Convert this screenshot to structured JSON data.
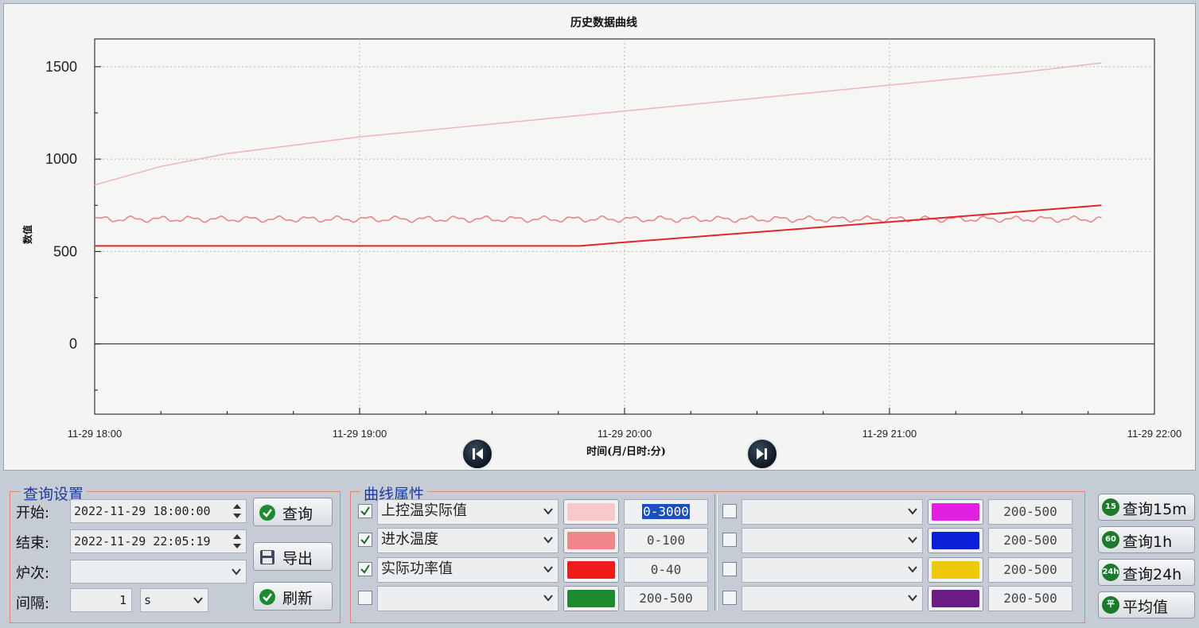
{
  "chart": {
    "title": "历史数据曲线",
    "ylabel": "数值",
    "xlabel": "时间(月/日时:分)",
    "ytick_labels": [
      "1500",
      "1000",
      "500",
      "0"
    ],
    "xtick_labels": [
      "11-29 18:00",
      "11-29 19:00",
      "11-29 20:00",
      "11-29 21:00",
      "11-29 22:00"
    ]
  },
  "chart_data": {
    "type": "line",
    "x_unit": "hours since 11-29 18:00",
    "xlim": [
      0,
      4
    ],
    "ylim": [
      -380,
      1650
    ],
    "grid": true,
    "series": [
      {
        "color": "#f0b8bc",
        "x": [
          0,
          0.25,
          0.5,
          1,
          1.5,
          2,
          2.5,
          3,
          3.5,
          3.8
        ],
        "y": [
          860,
          960,
          1030,
          1120,
          1190,
          1260,
          1330,
          1400,
          1470,
          1520
        ]
      },
      {
        "color": "#e8868a",
        "x": [
          0,
          3.8
        ],
        "y": [
          675,
          675
        ],
        "wavy": true
      },
      {
        "color": "#e0262c",
        "x": [
          0,
          1.83,
          2,
          3,
          3.8
        ],
        "y": [
          530,
          530,
          550,
          660,
          750
        ]
      }
    ]
  },
  "query": {
    "title": "查询设置",
    "start_label": "开始:",
    "start_value": "2022-11-29 18:00:00",
    "end_label": "结束:",
    "end_value": "2022-11-29 22:05:19",
    "furnace_label": "炉次:",
    "furnace_value": "",
    "interval_label": "间隔:",
    "interval_value": "1",
    "interval_unit": "s",
    "query_button": "查询",
    "export_button": "导出",
    "refresh_button": "刷新"
  },
  "curves": {
    "title": "曲线属性",
    "left": [
      {
        "checked": true,
        "name": "上控温实际值",
        "color": "#f7c9cb",
        "range": "0-3000",
        "selected": true
      },
      {
        "checked": true,
        "name": "进水温度",
        "color": "#f0868a",
        "range": "0-100",
        "selected": false
      },
      {
        "checked": true,
        "name": "实际功率值",
        "color": "#ef1b1b",
        "range": "0-40",
        "selected": false
      },
      {
        "checked": false,
        "name": "",
        "color": "#1d8a2f",
        "range": "200-500",
        "selected": false
      }
    ],
    "right": [
      {
        "checked": false,
        "name": "",
        "color": "#e21fe0",
        "range": "200-500"
      },
      {
        "checked": false,
        "name": "",
        "color": "#0a21d8",
        "range": "200-500"
      },
      {
        "checked": false,
        "name": "",
        "color": "#f0c80a",
        "range": "200-500"
      },
      {
        "checked": false,
        "name": "",
        "color": "#6c1a86",
        "range": "200-500"
      }
    ]
  },
  "quick": {
    "q15_label": "查询15m",
    "q15_icon": "15",
    "q1h_label": "查询1h",
    "q1h_icon": "60",
    "q24h_label": "查询24h",
    "q24h_icon": "24h",
    "avg_label": "平均值",
    "avg_icon": "平"
  }
}
